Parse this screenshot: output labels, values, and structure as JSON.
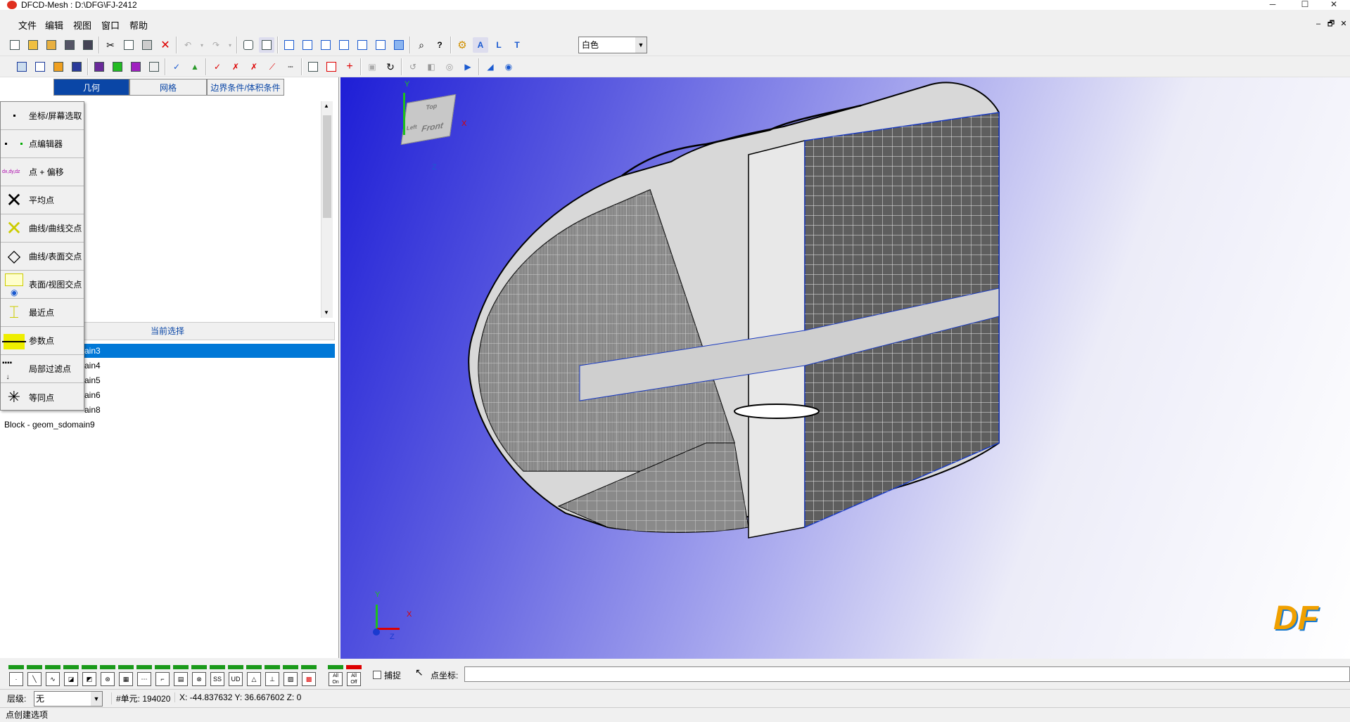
{
  "window": {
    "title": "DFCD-Mesh : D:\\DFG\\FJ-2412",
    "minimize": "─",
    "maximize": "☐",
    "close": "✕"
  },
  "menubar": {
    "items": [
      "文件",
      "编辑",
      "视图",
      "窗口",
      "帮助"
    ],
    "mdi": [
      "–",
      "🗗",
      "✕"
    ]
  },
  "toolbar": {
    "color_select": "白色"
  },
  "tabs": {
    "geometry": "几何",
    "mesh": "网格",
    "bc": "边界条件/体积条件"
  },
  "popup": {
    "items": [
      "坐标/屏幕选取",
      "点编辑器",
      "点 + 偏移",
      "平均点",
      "曲线/曲线交点",
      "曲线/表面交点",
      "表面/视图交点",
      "最近点",
      "参数点",
      "局部过滤点",
      "等同点"
    ]
  },
  "current_selection": {
    "label": "当前选择"
  },
  "list": {
    "items": [
      "ain3",
      "ain4",
      "ain5",
      "ain6",
      "ain8",
      "Block - geom_sdomain9"
    ],
    "selected_index": 0
  },
  "viewport": {
    "cube_faces": [
      "Top",
      "Front",
      "Left"
    ],
    "axes": {
      "x": "X",
      "y": "Y",
      "z": "Z"
    },
    "logo": "DF"
  },
  "bottom": {
    "snap_label": "捕捉",
    "coord_label": "点坐标:",
    "coord_value": "",
    "all_on": "All On",
    "all_off": "All Off"
  },
  "status": {
    "layer_label": "层级:",
    "layer_value": "无",
    "cells": "#单元: 194020",
    "coords": "X: -44.837632 Y: 36.667602 Z: 0"
  },
  "hint": "点创建选项"
}
